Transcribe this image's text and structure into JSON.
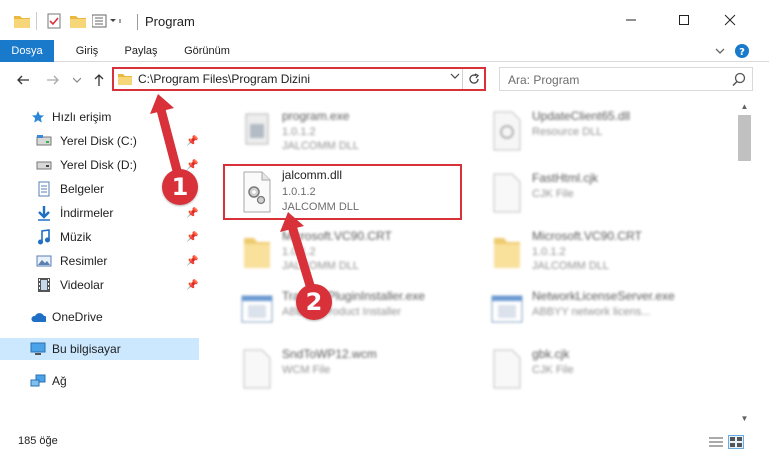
{
  "window": {
    "title": "Program",
    "controls": {
      "minimize": "minimize-icon",
      "maximize": "maximize-icon",
      "close": "close-icon"
    }
  },
  "ribbon": {
    "tabs": [
      "Dosya",
      "Giriş",
      "Paylaş",
      "Görünüm"
    ],
    "file_color": "#1979ca"
  },
  "address": {
    "path": "C:\\Program Files\\Program Dizini",
    "highlight_color": "#d9313a"
  },
  "search": {
    "placeholder": "Ara: Program"
  },
  "nav": {
    "quick_access": "Hızlı erişim",
    "items": [
      {
        "label": "Yerel Disk (C:)",
        "icon": "drive-icon",
        "pinned": true
      },
      {
        "label": "Yerel Disk (D:)",
        "icon": "drive-icon",
        "pinned": true
      },
      {
        "label": "Belgeler",
        "icon": "documents-icon",
        "pinned": true
      },
      {
        "label": "İndirmeler",
        "icon": "downloads-icon",
        "pinned": true
      },
      {
        "label": "Müzik",
        "icon": "music-icon",
        "pinned": true
      },
      {
        "label": "Resimler",
        "icon": "pictures-icon",
        "pinned": true
      },
      {
        "label": "Videolar",
        "icon": "videos-icon",
        "pinned": true
      }
    ],
    "onedrive": "OneDrive",
    "this_pc": "Bu bilgisayar",
    "network": "Ağ"
  },
  "files": [
    {
      "name": "program.exe",
      "version": "1.0.1.2",
      "desc": "JALCOMM DLL",
      "icon": "exe-icon",
      "blurred": true
    },
    {
      "name": "UpdateClient65.dll",
      "version": "",
      "desc": "Resource DLL",
      "icon": "dll-icon",
      "blurred": true
    },
    {
      "name": "jalcomm.dll",
      "version": "1.0.1.2",
      "desc": "JALCOMM DLL",
      "icon": "dll-gear-icon",
      "blurred": false
    },
    {
      "name": "FastHtml.cjk",
      "version": "",
      "desc": "CJK File",
      "icon": "generic-file-icon",
      "blurred": true
    },
    {
      "name": "Microsoft.VC90.CRT",
      "version": "1.0.1.2",
      "desc": "JALCOMM DLL",
      "icon": "folder-icon",
      "blurred": true
    },
    {
      "name": "Microsoft.VC90.CRT",
      "version": "1.0.1.2",
      "desc": "JALCOMM DLL",
      "icon": "folder-icon",
      "blurred": true
    },
    {
      "name": "TrackingPluginInstaller.exe",
      "version": "",
      "desc": "ABBYY Product Installer",
      "icon": "app-window-icon",
      "blurred": true
    },
    {
      "name": "NetworkLicenseServer.exe",
      "version": "",
      "desc": "ABBYY network licens...",
      "icon": "app-window-icon",
      "blurred": true
    },
    {
      "name": "SndToWP12.wcm",
      "version": "",
      "desc": "WCM File",
      "icon": "generic-file-icon",
      "blurred": true
    },
    {
      "name": "gbk.cjk",
      "version": "",
      "desc": "CJK File",
      "icon": "generic-file-icon",
      "blurred": true
    }
  ],
  "callouts": [
    "1",
    "2"
  ],
  "status": {
    "item_count": "185 öğe"
  }
}
